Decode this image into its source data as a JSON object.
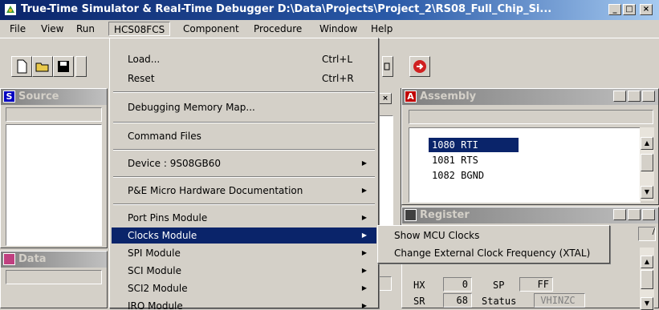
{
  "window": {
    "title": "True-Time Simulator & Real-Time Debugger   D:\\Data\\Projects\\Project_2\\RS08_Full_Chip_Si...",
    "min": "_",
    "max": "□",
    "close": "×"
  },
  "menubar": [
    "File",
    "View",
    "Run",
    "HCS08FCS",
    "Component",
    "Procedure",
    "Window",
    "Help"
  ],
  "dropdown": {
    "load": "Load...",
    "load_short": "Ctrl+L",
    "reset": "Reset",
    "reset_short": "Ctrl+R",
    "debug_map": "Debugging Memory Map...",
    "command_files": "Command Files",
    "device": "Device : 9S08GB60",
    "pe_doc": "P&E Micro Hardware Documentation",
    "port_pins": "Port Pins Module",
    "clocks": "Clocks Module",
    "spi": "SPI Module",
    "sci": "SCI Module",
    "sci2": "SCI2 Module",
    "irq": "IRQ Module"
  },
  "submenu": {
    "show_clocks": "Show MCU Clocks",
    "change_freq": "Change External Clock Frequency (XTAL)"
  },
  "panes": {
    "source": "Source",
    "data": "Data",
    "assembly": "Assembly",
    "register": "Register"
  },
  "assembly_lines": [
    {
      "addr": "1080",
      "instr": "RTI"
    },
    {
      "addr": "1081",
      "instr": "RTS"
    },
    {
      "addr": "1082",
      "instr": "BGND"
    }
  ],
  "registers": {
    "hx_label": "HX",
    "hx_value": "0",
    "sp_label": "SP",
    "sp_value": "FF",
    "sr_label": "SR",
    "sr_value": "68",
    "status_label": "Status",
    "status_value": "VHINZC"
  },
  "colors": {
    "selection": "#0a246a",
    "title_start": "#0a246a"
  }
}
